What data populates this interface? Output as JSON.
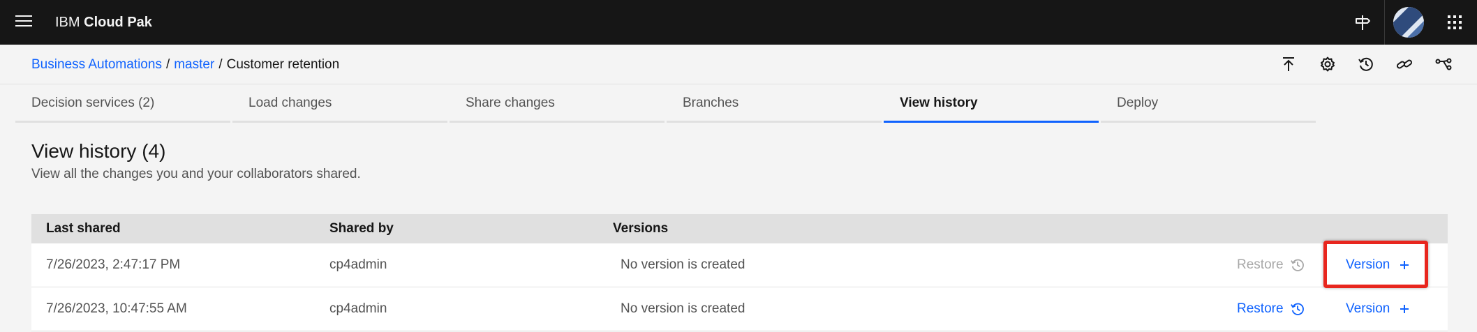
{
  "header": {
    "brand_prefix": "IBM",
    "brand_name": "Cloud Pak",
    "icons": [
      "menu-icon",
      "signpost-icon",
      "user-avatar",
      "app-switcher-icon"
    ]
  },
  "breadcrumb": {
    "items": [
      "Business Automations",
      "master",
      "Customer retention"
    ],
    "separator": "/"
  },
  "actions": {
    "icons": [
      "share-upload-icon",
      "settings-icon",
      "history-icon",
      "link-icon",
      "branch-icon"
    ]
  },
  "tabs": [
    {
      "label": "Decision services (2)"
    },
    {
      "label": "Load changes"
    },
    {
      "label": "Share changes"
    },
    {
      "label": "Branches"
    },
    {
      "label": "View history",
      "active": true
    },
    {
      "label": "Deploy"
    }
  ],
  "main": {
    "title": "View history (4)",
    "subtitle": "View all the changes you and your collaborators shared."
  },
  "table": {
    "columns": [
      "Last shared",
      "Shared by",
      "Versions"
    ],
    "rows": [
      {
        "last_shared": "7/26/2023, 2:47:17 PM",
        "shared_by": "cp4admin",
        "versions": "No version is created",
        "restore": "Restore",
        "version": "Version"
      },
      {
        "last_shared": "7/26/2023, 10:47:55 AM",
        "shared_by": "cp4admin",
        "versions": "No version is created",
        "restore": "Restore",
        "version": "Version"
      }
    ]
  },
  "colors": {
    "accent": "#0f62fe",
    "highlight": "#e8261e",
    "header_bg": "#161616"
  }
}
